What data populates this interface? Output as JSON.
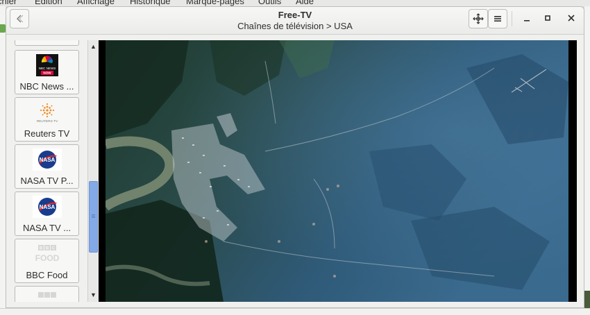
{
  "background_menu": [
    "chier",
    "Édition",
    "Affichage",
    "Historique",
    "Marque-pages",
    "Outils",
    "Aide"
  ],
  "window": {
    "title": "Free-TV",
    "subtitle": "Chaînes de télévision > USA"
  },
  "channels": [
    {
      "name": "",
      "logo": "partial-logo",
      "partial": true
    },
    {
      "name": "NBC News ...",
      "logo": "nbc-news-now-logo"
    },
    {
      "name": "Reuters TV",
      "logo": "reuters-logo"
    },
    {
      "name": "NASA TV P...",
      "logo": "nasa-logo"
    },
    {
      "name": "NASA TV ...",
      "logo": "nasa-logo"
    },
    {
      "name": "BBC Food",
      "logo": "bbc-food-logo"
    },
    {
      "name": "",
      "logo": "bbc-logo",
      "partial": true
    }
  ],
  "logo_text": {
    "nbc": "NBC NEWS",
    "nbc_now": "NOW",
    "reuters": "REUTERS TV",
    "nasa": "NASA",
    "bbc": "BBC",
    "food": "FOOD"
  },
  "colors": {
    "accent": "#83a9e6",
    "nasa_blue": "#1a3c8c",
    "nasa_red": "#d8282e",
    "reuters_orange": "#f08a24"
  }
}
